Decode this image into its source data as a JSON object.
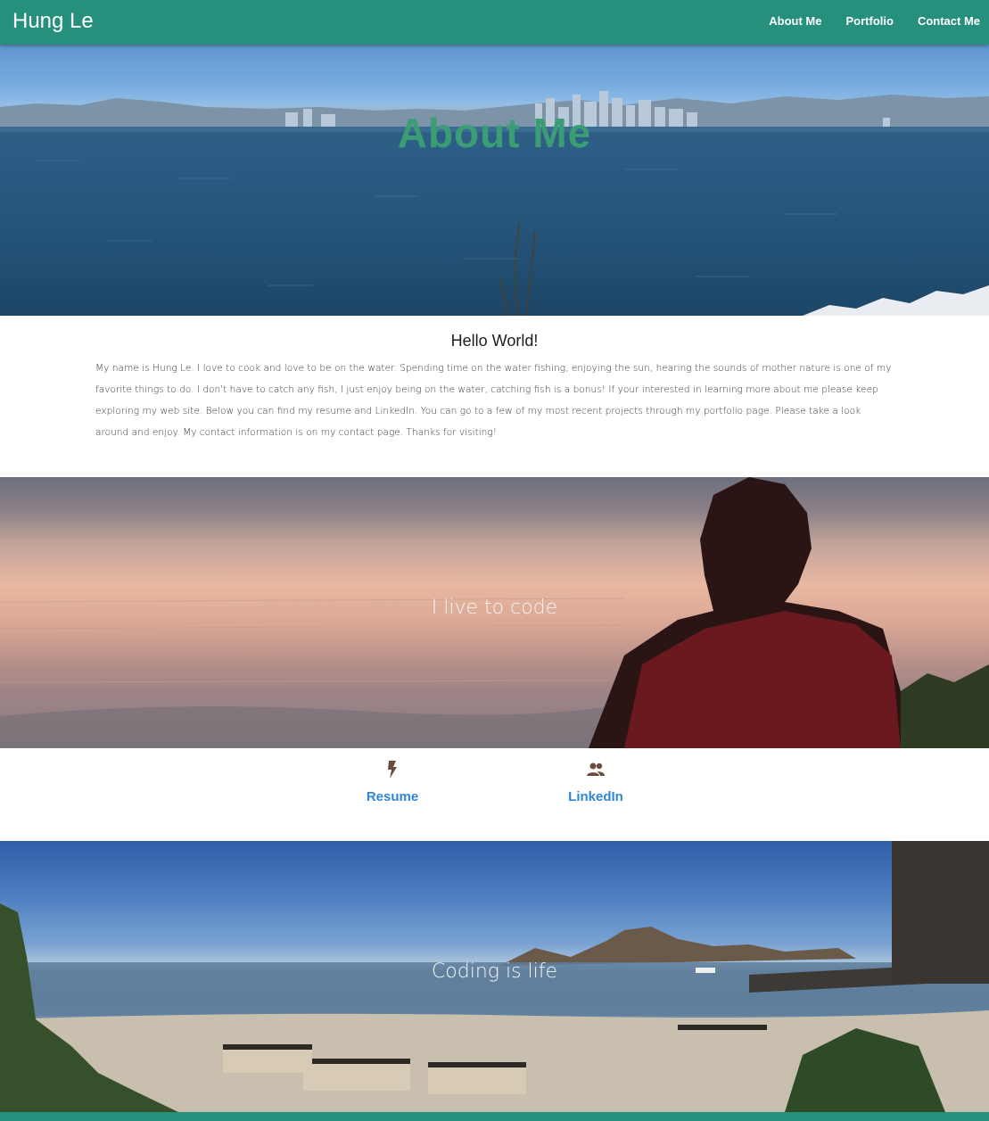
{
  "navbar": {
    "brand": "Hung Le",
    "links": [
      "About Me",
      "Portfolio",
      "Contact Me"
    ]
  },
  "hero": {
    "title": "About Me"
  },
  "intro": {
    "heading": "Hello World!",
    "body": "My name is Hung Le. I love to cook and love to be on the water. Spending time on the water fishing, enjoying the sun, hearing the sounds of mother nature is one of my favorite things to do. I don't have to catch any fish, I just enjoy being on the water, catching fish is a bonus! If your interested in learning more about me please keep exploring my web site. Below you can find my resume and LinkedIn. You can go to a few of my most recent projects through my portfolio page. Please take a look around and enjoy. My contact information is on my contact page. Thanks for visiting!"
  },
  "sunset": {
    "caption": "I live to code"
  },
  "links": {
    "resume": {
      "label": "Resume",
      "icon": "bolt-icon"
    },
    "linkedin": {
      "label": "LinkedIn",
      "icon": "people-icon"
    }
  },
  "beach": {
    "caption": "Coding is life"
  },
  "colors": {
    "nav": "#26907c",
    "hero_title": "#3a9d73",
    "link": "#2f86d6",
    "icon": "#6b4b3e"
  }
}
